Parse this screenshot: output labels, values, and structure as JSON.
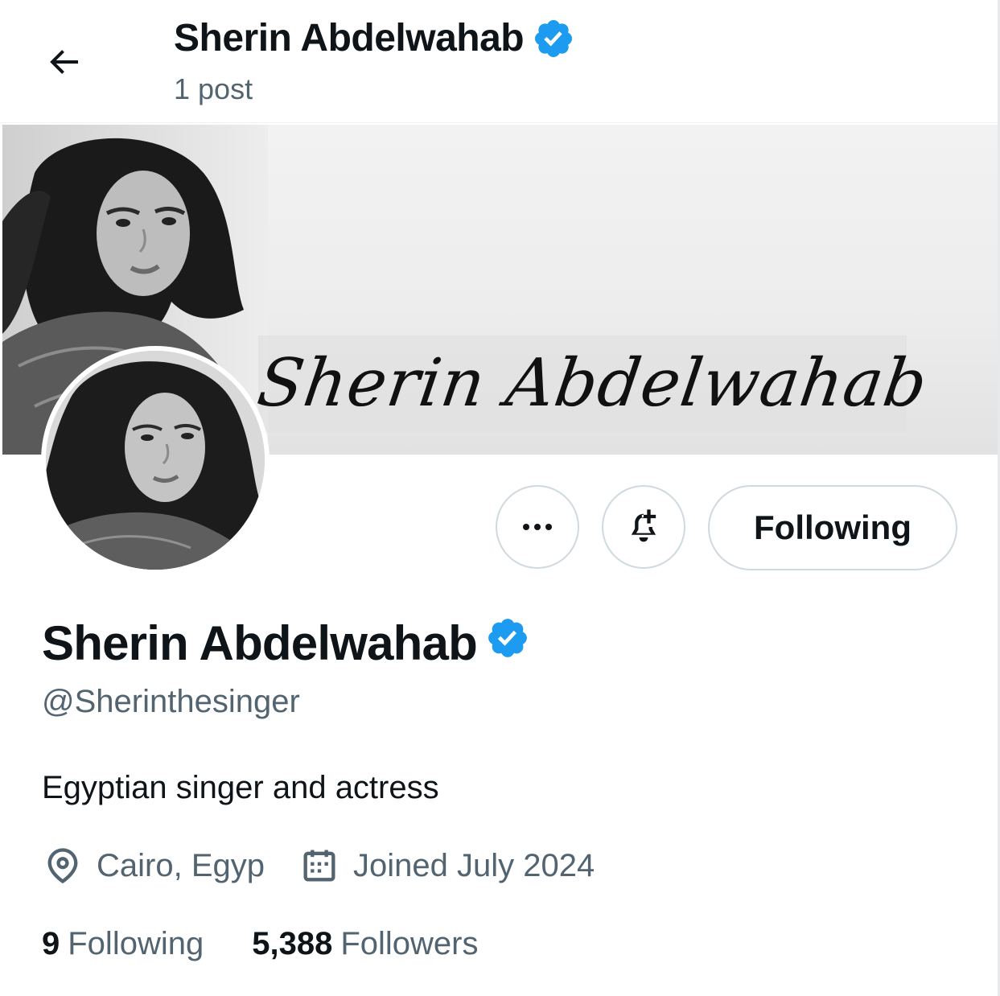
{
  "header": {
    "name": "Sherin Abdelwahab",
    "post_count": "1 post"
  },
  "banner": {
    "script_text": "Sherin Abdelwahab"
  },
  "actions": {
    "following_label": "Following"
  },
  "profile": {
    "name": "Sherin Abdelwahab",
    "handle": "@Sherinthesinger",
    "bio": "Egyptian singer and actress",
    "location": "Cairo, Egyp",
    "joined": "Joined July 2024",
    "following_count": "9",
    "following_label": "Following",
    "followers_count": "5,388",
    "followers_label": "Followers"
  },
  "colors": {
    "verified": "#1d9bf0",
    "text_primary": "#0f1419",
    "text_secondary": "#536471",
    "border": "#cfd9de"
  },
  "icons": {
    "back": "arrow-left-icon",
    "verified": "verified-badge-icon",
    "more": "more-dots-icon",
    "notify": "bell-plus-icon",
    "location": "location-pin-icon",
    "calendar": "calendar-icon"
  }
}
